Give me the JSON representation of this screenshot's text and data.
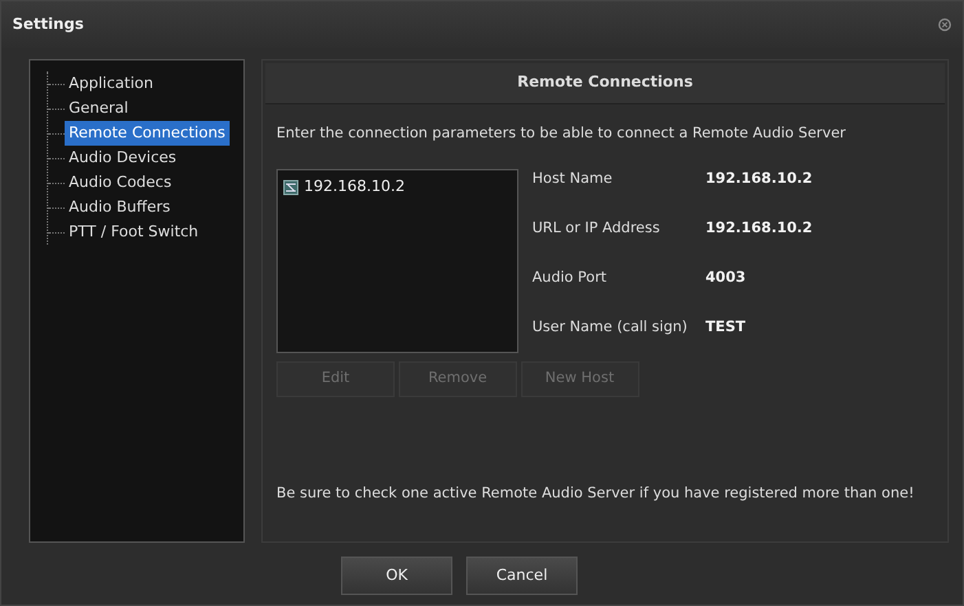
{
  "window": {
    "title": "Settings"
  },
  "sidebar": {
    "items": [
      {
        "label": "Application",
        "selected": false
      },
      {
        "label": "General",
        "selected": false
      },
      {
        "label": "Remote Connections",
        "selected": true
      },
      {
        "label": "Audio Devices",
        "selected": false
      },
      {
        "label": "Audio Codecs",
        "selected": false
      },
      {
        "label": "Audio Buffers",
        "selected": false
      },
      {
        "label": "PTT / Foot Switch",
        "selected": false
      }
    ]
  },
  "panel": {
    "title": "Remote Connections",
    "description": "Enter the connection parameters to be able to connect a Remote Audio Server",
    "hosts": [
      {
        "label": "192.168.10.2",
        "selected": false
      }
    ],
    "details": [
      {
        "label": "Host Name",
        "value": "192.168.10.2"
      },
      {
        "label": "URL or IP Address",
        "value": "192.168.10.2"
      },
      {
        "label": "Audio Port",
        "value": "4003"
      },
      {
        "label": "User Name (call sign)",
        "value": "TEST"
      }
    ],
    "buttons": [
      {
        "label": "Edit",
        "disabled": true
      },
      {
        "label": "Remove",
        "disabled": true
      },
      {
        "label": "New Host",
        "disabled": true
      }
    ],
    "note": "Be sure to check one active Remote Audio Server if you have registered more than one!"
  },
  "buttons": [
    {
      "label": "OK",
      "disabled": false
    },
    {
      "label": "Cancel",
      "disabled": false
    }
  ]
}
